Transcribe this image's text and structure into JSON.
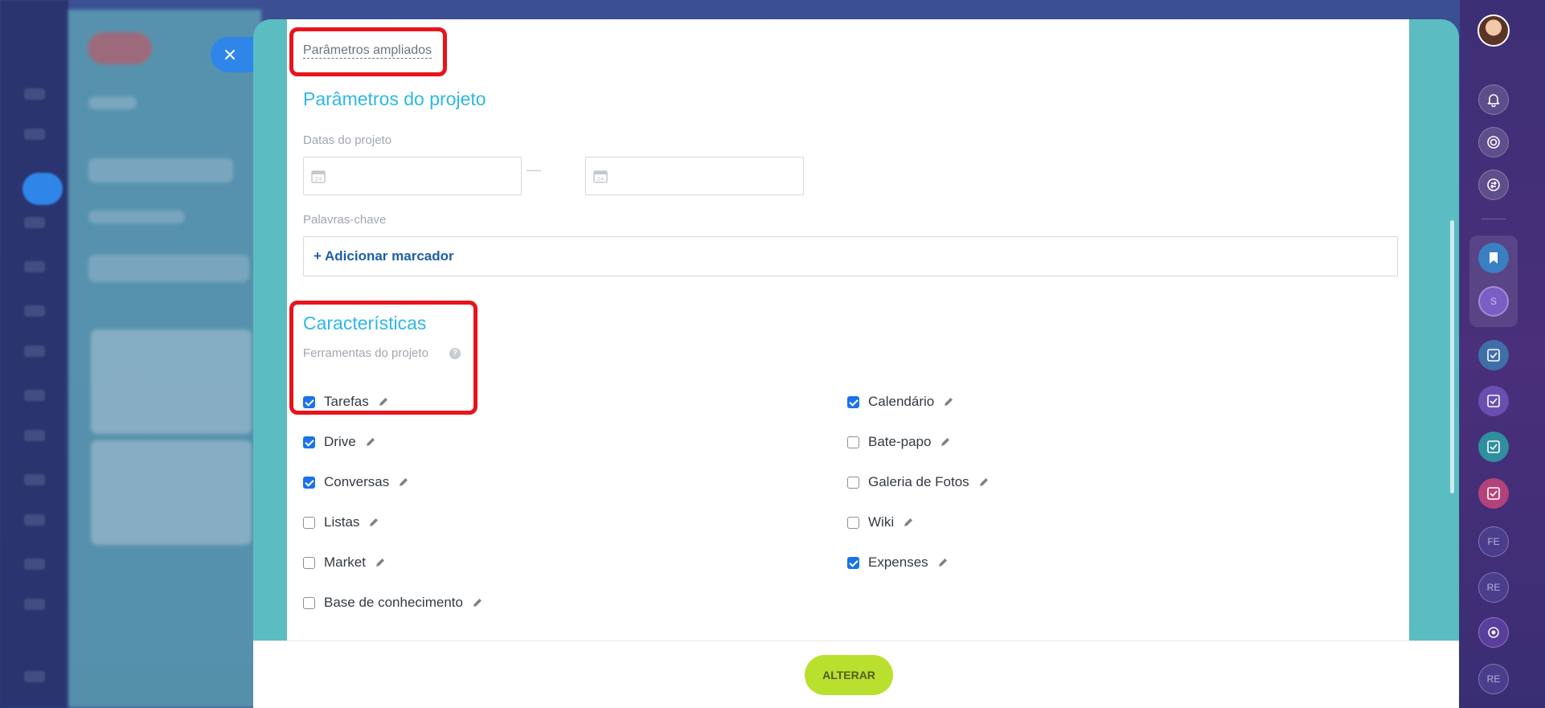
{
  "panel": {
    "extended_link": "Parâmetros ampliados",
    "project_params_title": "Parâmetros do projeto",
    "project_dates_label": "Datas do projeto",
    "date_start_value": "",
    "date_end_value": "",
    "date_separator": "—",
    "keywords_label": "Palavras-chave",
    "add_tag_label": "+ Adicionar marcador",
    "features_title": "Características",
    "tools_label": "Ferramentas do projeto",
    "help_symbol": "?"
  },
  "features_left": [
    {
      "label": "Tarefas",
      "checked": true
    },
    {
      "label": "Drive",
      "checked": true
    },
    {
      "label": "Conversas",
      "checked": true
    },
    {
      "label": "Listas",
      "checked": false
    },
    {
      "label": "Market",
      "checked": false
    },
    {
      "label": "Base de conhecimento",
      "checked": false
    }
  ],
  "features_right": [
    {
      "label": "Calendário",
      "checked": true
    },
    {
      "label": "Bate-papo",
      "checked": false
    },
    {
      "label": "Galeria de Fotos",
      "checked": false
    },
    {
      "label": "Wiki",
      "checked": false
    },
    {
      "label": "Expenses",
      "checked": true
    }
  ],
  "footer": {
    "submit_label": "ALTERAR"
  },
  "right_bar": {
    "group_initial": "S",
    "avatar_labels": [
      "FE",
      "RE",
      "RE"
    ]
  },
  "colors": {
    "accent_blue": "#2fb7e6",
    "checkbox_blue": "#1a73e8",
    "submit_green": "#b9e02f",
    "highlight_red": "#e8141b",
    "panel_teal": "#5bbcc2"
  },
  "icons": {
    "close": "close-icon",
    "calendar": "calendar-icon",
    "edit": "pencil-icon",
    "bell": "bell-icon",
    "target": "target-icon",
    "sync": "sync-icon",
    "bookmark": "bookmark-icon",
    "task": "task-icon"
  }
}
